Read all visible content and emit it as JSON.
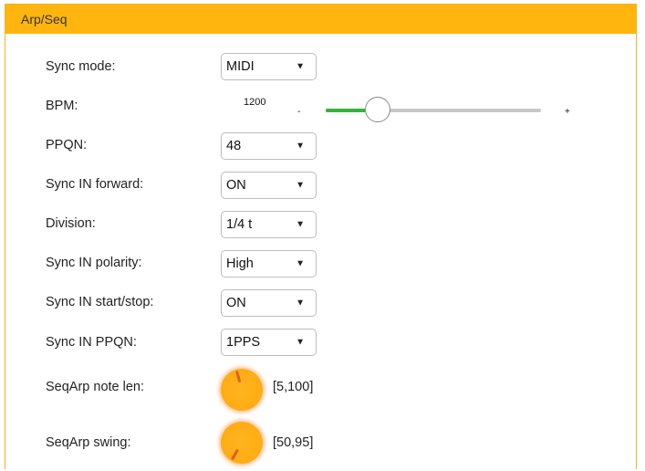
{
  "panel": {
    "title": "Arp/Seq"
  },
  "rows": {
    "sync_mode": {
      "label": "Sync mode:",
      "value": "MIDI"
    },
    "bpm": {
      "label": "BPM:",
      "value": "1200",
      "minus": "-",
      "plus": "+",
      "level": 0.24
    },
    "ppqn": {
      "label": "PPQN:",
      "value": "48"
    },
    "sync_in_forward": {
      "label": "Sync IN forward:",
      "value": "ON"
    },
    "division": {
      "label": "Division:",
      "value": "1/4 t"
    },
    "sync_in_polarity": {
      "label": "Sync IN polarity:",
      "value": "High"
    },
    "sync_in_start_stop": {
      "label": "Sync IN start/stop:",
      "value": "ON"
    },
    "sync_in_ppqn": {
      "label": "Sync IN PPQN:",
      "value": "1PPS"
    },
    "seqarp_note_len": {
      "label": "SeqArp note len:",
      "range": "[5,100]",
      "knob_angle_deg": -15
    },
    "seqarp_swing": {
      "label": "SeqArp swing:",
      "range": "[50,95]",
      "knob_angle_deg": -150
    }
  },
  "icons": {
    "dropdown": "chevron-down-icon",
    "arrow_glyph": "▼"
  },
  "colors": {
    "header": "#ffb50d",
    "border": "#f6b31b",
    "slider_fill": "#35b33e",
    "slider_track": "#c8c8c8",
    "knob": "#ffad14",
    "knob_indicator": "#e0601a"
  }
}
